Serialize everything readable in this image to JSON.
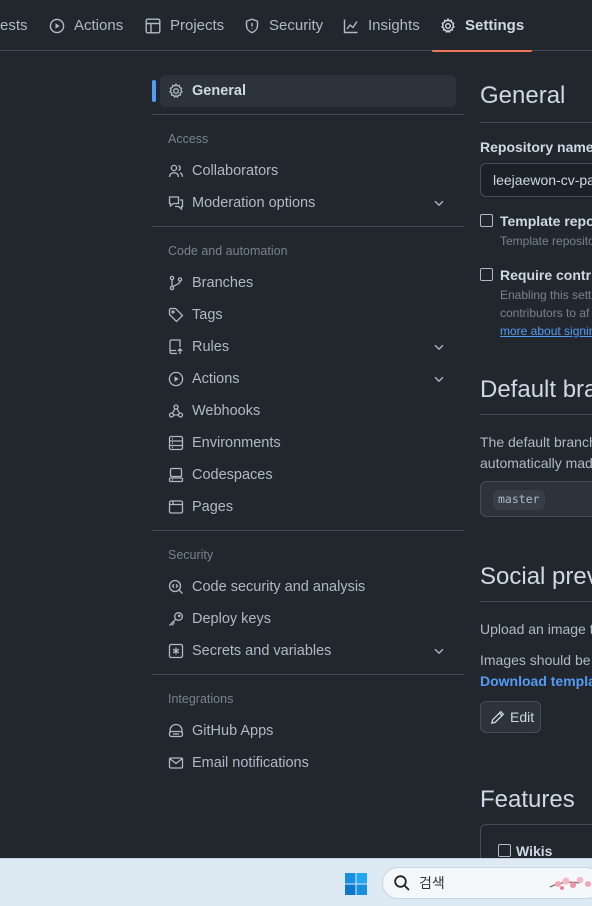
{
  "topnav": {
    "tabs": [
      {
        "label": "ests",
        "icon": ""
      },
      {
        "label": "Actions",
        "icon": "play-circle-icon"
      },
      {
        "label": "Projects",
        "icon": "table-icon"
      },
      {
        "label": "Security",
        "icon": "shield-icon"
      },
      {
        "label": "Insights",
        "icon": "graph-icon"
      },
      {
        "label": "Settings",
        "icon": "gear-icon",
        "active": true
      }
    ]
  },
  "sidebar": {
    "general": "General",
    "sections": [
      {
        "heading": "Access",
        "items": [
          {
            "label": "Collaborators",
            "icon": "people-icon"
          },
          {
            "label": "Moderation options",
            "icon": "comment-discussion-icon",
            "expandable": true
          }
        ]
      },
      {
        "heading": "Code and automation",
        "items": [
          {
            "label": "Branches",
            "icon": "git-branch-icon"
          },
          {
            "label": "Tags",
            "icon": "tag-icon"
          },
          {
            "label": "Rules",
            "icon": "repo-push-icon",
            "expandable": true
          },
          {
            "label": "Actions",
            "icon": "play-icon",
            "expandable": true
          },
          {
            "label": "Webhooks",
            "icon": "webhook-icon"
          },
          {
            "label": "Environments",
            "icon": "server-icon"
          },
          {
            "label": "Codespaces",
            "icon": "codespaces-icon"
          },
          {
            "label": "Pages",
            "icon": "browser-icon"
          }
        ]
      },
      {
        "heading": "Security",
        "items": [
          {
            "label": "Code security and analysis",
            "icon": "codescan-icon"
          },
          {
            "label": "Deploy keys",
            "icon": "key-icon"
          },
          {
            "label": "Secrets and variables",
            "icon": "asterisk-icon",
            "expandable": true
          }
        ]
      },
      {
        "heading": "Integrations",
        "items": [
          {
            "label": "GitHub Apps",
            "icon": "hubot-icon"
          },
          {
            "label": "Email notifications",
            "icon": "mail-icon"
          }
        ]
      }
    ]
  },
  "main": {
    "title": "General",
    "repo_name_label": "Repository name",
    "repo_name_value": "leejaewon-cv-pa",
    "template_label": "Template repos",
    "template_note": "Template reposito",
    "signoff_label": "Require contrib",
    "signoff_note1": "Enabling this setti",
    "signoff_note2": "contributors to af",
    "signoff_link": "more about signin",
    "default_branch_title": "Default bra",
    "default_branch_text1": "The default branch",
    "default_branch_text2": "automatically mad",
    "default_branch_value": "master",
    "social_title": "Social prev",
    "social_text1": "Upload an image t",
    "social_text2": "Images should be",
    "social_link": "Download templa",
    "edit_label": "Edit",
    "features_title": "Features",
    "wikis_label": "Wikis"
  },
  "taskbar": {
    "search_placeholder": "검색"
  },
  "colors": {
    "background": "#22272e",
    "accent_underline": "#ec775c",
    "active_indicator": "#539bf5",
    "link": "#539bf5"
  }
}
